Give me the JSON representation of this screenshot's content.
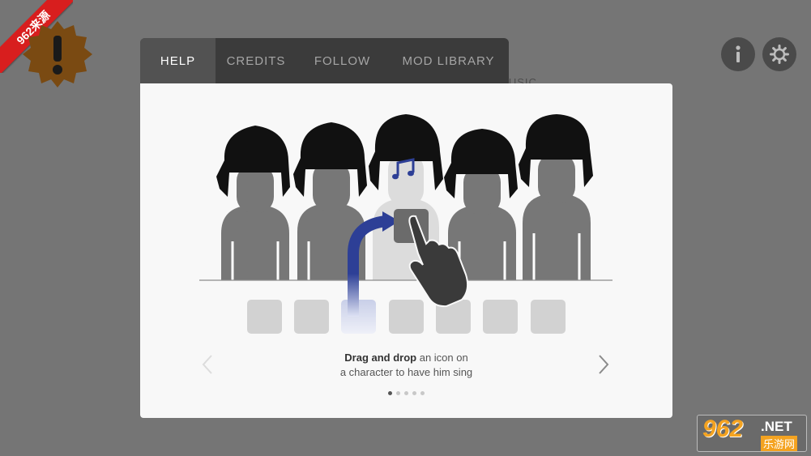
{
  "watermark_ribbon": "962来源",
  "background_label": "MUSIC",
  "tabs": [
    {
      "label": "HELP",
      "active": true
    },
    {
      "label": "CREDITS",
      "active": false
    },
    {
      "label": "FOLLOW",
      "active": false
    },
    {
      "label": "MOD LIBRARY",
      "active": false
    }
  ],
  "help": {
    "caption_bold": "Drag and drop",
    "caption_rest": " an icon on",
    "caption_line2": "a character to have him sing",
    "page_index": 1,
    "page_count": 5
  },
  "icons": {
    "alert": "exclamation-badge-icon",
    "info": "info-icon",
    "settings": "gear-icon",
    "prev": "chevron-left-icon",
    "next": "chevron-right-icon",
    "note": "music-note-icon",
    "hand": "pointing-hand-icon"
  },
  "watermark_site": {
    "number": "962",
    "domain": ".NET",
    "sub": "乐游网"
  },
  "colors": {
    "background": "#757575",
    "tab_bar": "#3b3b3b",
    "tab_active": "#525252",
    "panel": "#f8f8f8",
    "accent_blue": "#2d3f96",
    "badge": "#7a4a12",
    "ribbon": "#d81e1e"
  }
}
